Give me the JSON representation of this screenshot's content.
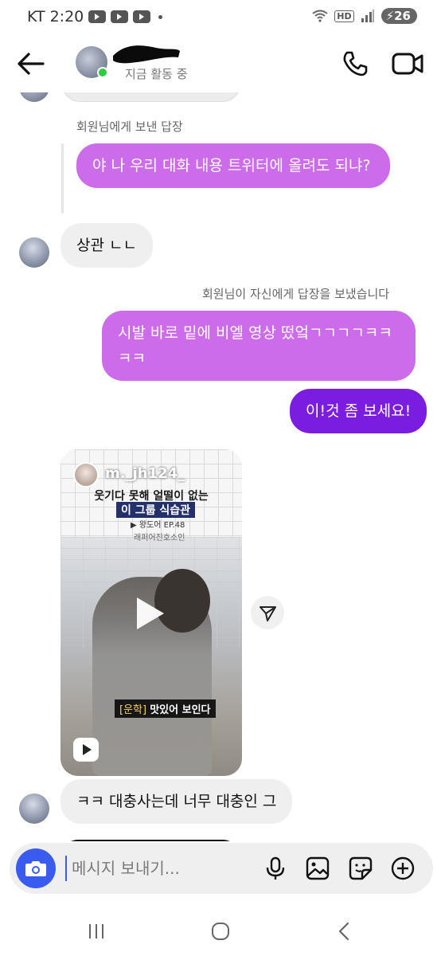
{
  "status_bar": {
    "carrier": "KT",
    "time": "2:20",
    "battery": "26"
  },
  "header": {
    "status": "지금 활동 중"
  },
  "messages": {
    "reply_meta_1": "회원님에게 보낸 답장",
    "quoted_1": "야 나 우리 대화 내용 트위터에 올려도 되냐?",
    "in_1": "상관 ㄴㄴ",
    "reply_meta_2": "회원님이 자신에게 답장을 보냈습니다",
    "quoted_2": "시발 바로 밑에 비엘 영상 떴엌ㄱㄱㄱㄱㅋㅋㅋㅋ",
    "out_1": "이!것 좀 보세요!",
    "in_2": "ㅋㅋ 대충사는데 너무 대충인 그"
  },
  "reel": {
    "username": "m._jh124_",
    "caption_line1": "웃기다 못해 얼떨이 없는",
    "caption_line2": "이 그룹 식습관",
    "caption_line3": "▶ 왕도어 EP.48",
    "caption_line4": "래퍼어진호소인",
    "subtitle_tag": "[운학]",
    "subtitle_text": "맛있어 보인다"
  },
  "composer": {
    "placeholder": "메시지 보내기..."
  },
  "colors": {
    "accent": "#3a5bf0",
    "outgoing": "#7b1de0",
    "quoted": "#cc6cea",
    "incoming": "#efefef"
  }
}
